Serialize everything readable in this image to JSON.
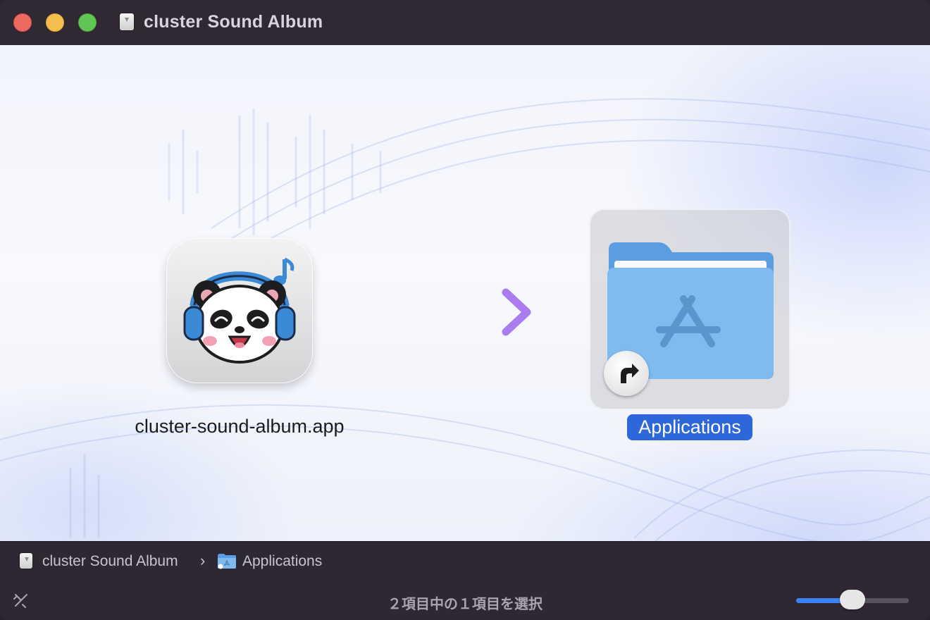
{
  "window": {
    "title": "cluster Sound Album",
    "title_icon": "disk-image-icon"
  },
  "content": {
    "app_item": {
      "label": "cluster-sound-album.app",
      "icon": "panda-headphones-app-icon"
    },
    "arrow": {
      "icon": "right-arrow-icon",
      "gradient": [
        "#7aa2f7",
        "#a97cf0"
      ]
    },
    "applications_item": {
      "label": "Applications",
      "icon": "applications-folder-icon",
      "badge": "alias-arrow-icon",
      "selected": true
    }
  },
  "path_bar": {
    "items": [
      {
        "label": "cluster Sound Album",
        "icon": "disk-image-icon"
      },
      {
        "label": "Applications",
        "icon": "applications-folder-icon"
      }
    ],
    "separator": "›"
  },
  "status_bar": {
    "text": "２項目中の１項目を選択",
    "icon_size_slider": 0.5
  },
  "colors": {
    "selection": "#2d67d9",
    "slider_fill": "#3b82f6",
    "close": "#ed6a5e",
    "minimize": "#f5bf4f",
    "maximize": "#61c554"
  }
}
